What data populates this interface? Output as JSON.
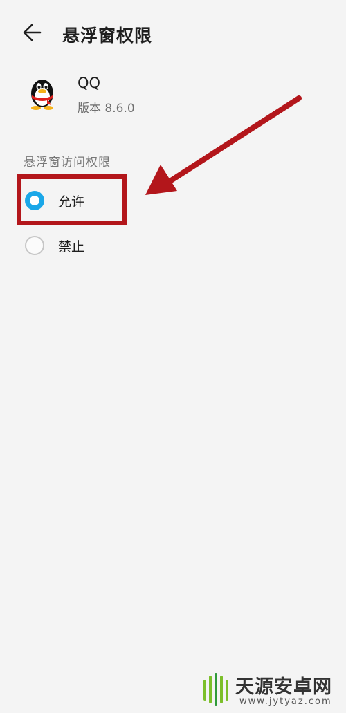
{
  "header": {
    "title": "悬浮窗权限",
    "back_icon": "arrow-left-icon"
  },
  "app": {
    "name": "QQ",
    "version": "版本 8.6.0",
    "icon": "qq-penguin-icon"
  },
  "permission": {
    "section_title": "悬浮窗访问权限",
    "options": [
      {
        "label": "允许",
        "selected": true
      },
      {
        "label": "禁止",
        "selected": false
      }
    ]
  },
  "annotation": {
    "box_color": "#b3161b",
    "arrow_color": "#b3161b"
  },
  "colors": {
    "accent": "#1aa7e8",
    "background": "#f4f4f4"
  },
  "watermark": {
    "brand": "天源安卓网",
    "url": "www.jytyaz.com"
  }
}
